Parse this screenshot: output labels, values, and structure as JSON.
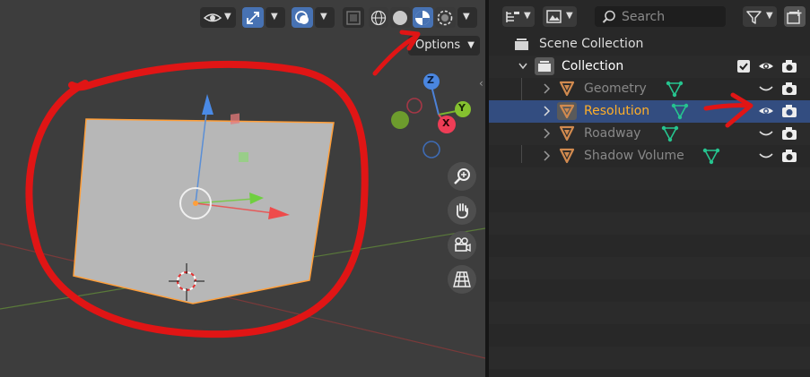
{
  "colors": {
    "accent_blue": "#4772b3",
    "selected_row": "#334d80",
    "active_label": "#ffaf29",
    "object_icon": "#d18a4f",
    "mesh_data_icon": "#26c48f",
    "annotation_red": "#e01515"
  },
  "viewport": {
    "header": {
      "visibility_icon": "eye-visibility-icon",
      "gizmo_icon": "transform-gizmo-icon",
      "overlay_icon": "overlay-icon",
      "xray_icon": "xray-icon",
      "shading_modes": [
        "wireframe-icon",
        "solid-icon",
        "material-preview-icon",
        "rendered-icon"
      ],
      "active_shading": "material-preview-icon"
    },
    "options_label": "Options",
    "gizmo_axes": {
      "z": "Z",
      "y": "Y",
      "x": "X"
    },
    "nav_buttons": [
      "zoom-icon",
      "pan-hand-icon",
      "camera-icon",
      "grid-perspective-icon"
    ]
  },
  "outliner": {
    "search_placeholder": "Search",
    "scene_collection_label": "Scene Collection",
    "collection": {
      "label": "Collection",
      "checked": true
    },
    "objects": [
      {
        "label": "Geometry",
        "visible": false,
        "selected": false
      },
      {
        "label": "Resolution",
        "visible": true,
        "selected": true
      },
      {
        "label": "Roadway",
        "visible": false,
        "selected": false
      },
      {
        "label": "Shadow Volume",
        "visible": false,
        "selected": false
      }
    ]
  }
}
